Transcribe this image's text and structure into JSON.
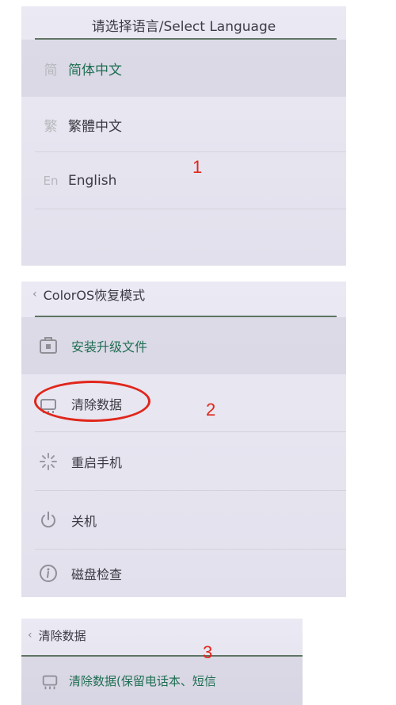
{
  "language_screen": {
    "title": "请选择语言/Select Language",
    "items": [
      {
        "icon_char": "简",
        "label": "简体中文",
        "selected": true
      },
      {
        "icon_char": "繁",
        "label": "繁體中文",
        "selected": false
      },
      {
        "icon_char": "En",
        "label": "English",
        "selected": false
      }
    ],
    "step_label": "1"
  },
  "recovery_screen": {
    "back_icon": "chevron-left-icon",
    "title": "ColorOS恢复模式",
    "items": [
      {
        "icon": "install-package-icon",
        "label": "安装升级文件",
        "selected": true
      },
      {
        "icon": "clear-data-icon",
        "label": "清除数据",
        "selected": false
      },
      {
        "icon": "restart-spinner-icon",
        "label": "重启手机",
        "selected": false
      },
      {
        "icon": "power-icon",
        "label": "关机",
        "selected": false
      },
      {
        "icon": "info-icon",
        "label": "磁盘检查",
        "selected": false
      }
    ],
    "step_label": "2"
  },
  "clear_data_screen": {
    "back_icon": "chevron-left-icon",
    "title": "清除数据",
    "items": [
      {
        "icon": "clear-data-icon",
        "label": "清除数据(保留电话本、短信",
        "selected": true
      }
    ],
    "step_label": "3"
  },
  "colors": {
    "accent_green": "#1f6e52",
    "annotation_red": "#e0261b"
  }
}
